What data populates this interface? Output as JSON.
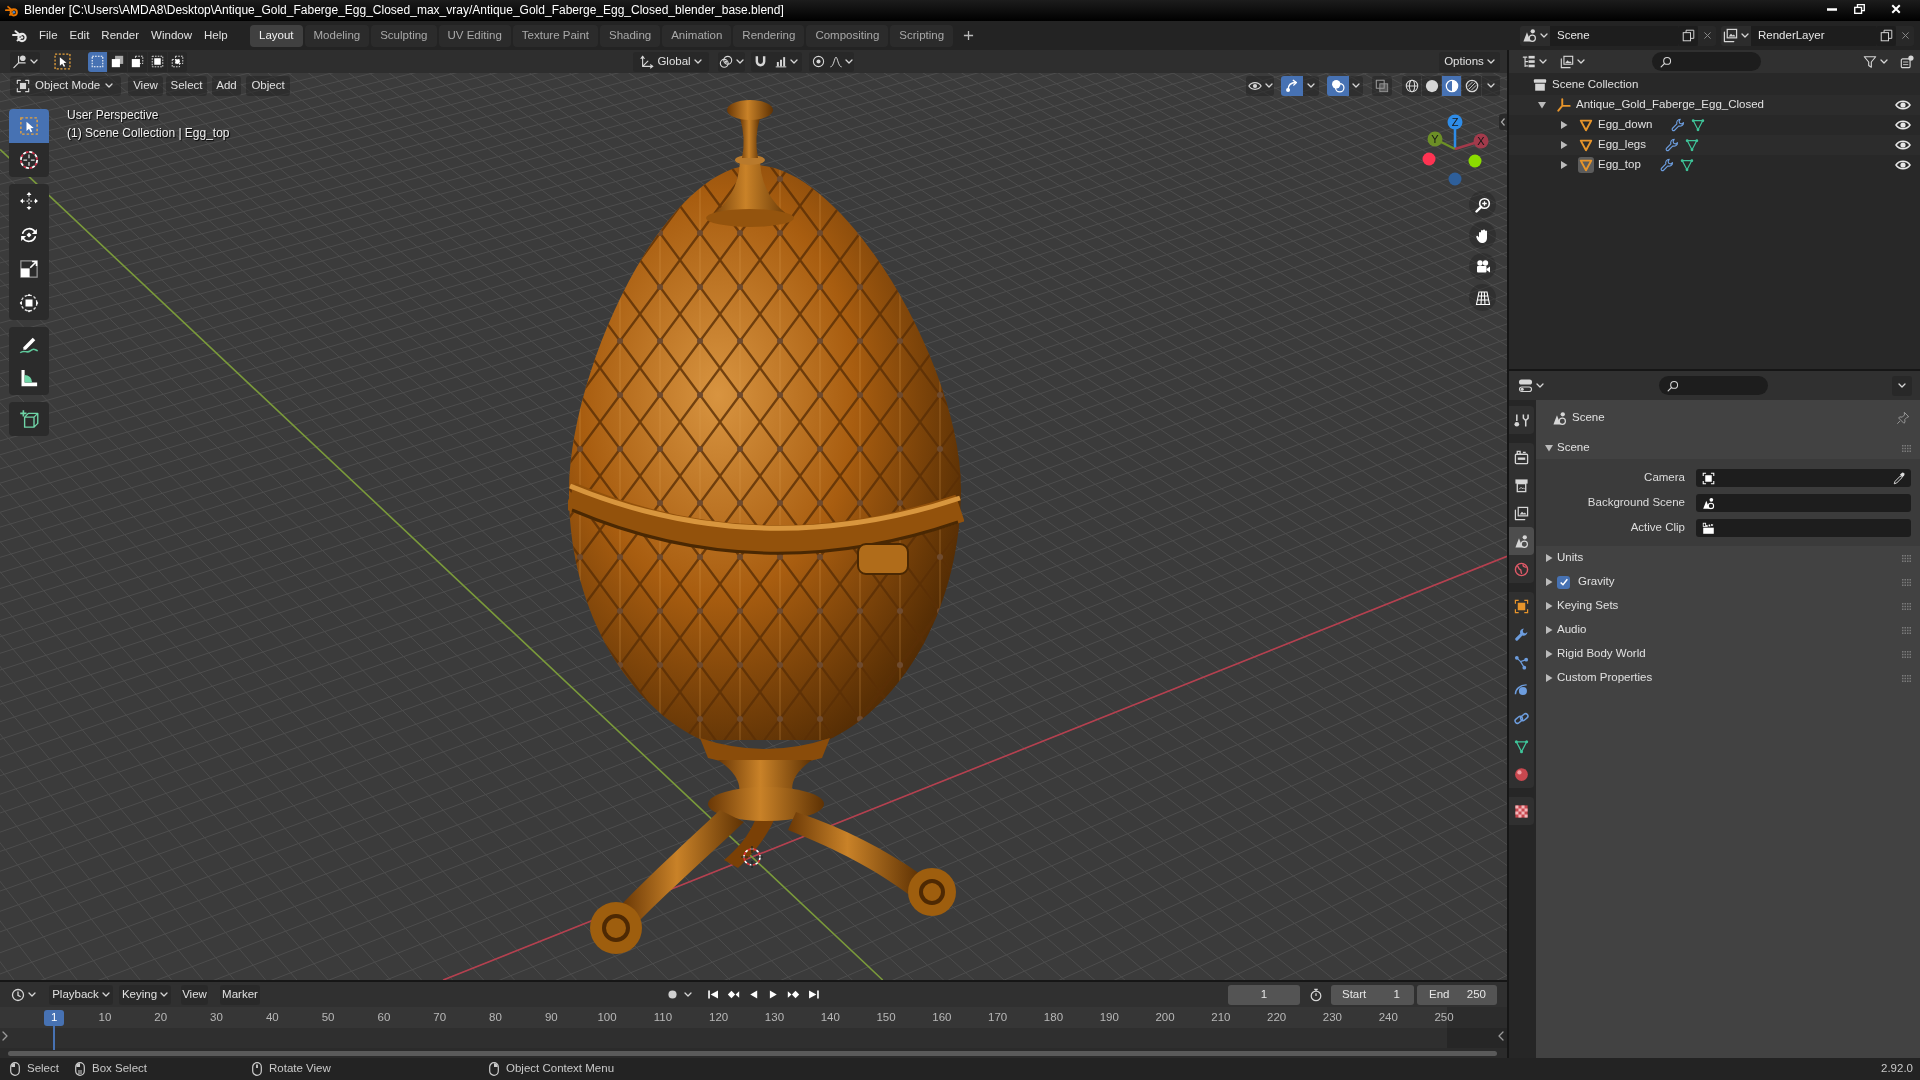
{
  "window": {
    "title": "Blender [C:\\Users\\AMDA8\\Desktop\\Antique_Gold_Faberge_Egg_Closed_max_vray/Antique_Gold_Faberge_Egg_Closed_blender_base.blend]"
  },
  "menu": [
    "File",
    "Edit",
    "Render",
    "Window",
    "Help"
  ],
  "workspaces": [
    {
      "label": "Layout",
      "selected": true
    },
    {
      "label": "Modeling",
      "selected": false
    },
    {
      "label": "Sculpting",
      "selected": false
    },
    {
      "label": "UV Editing",
      "selected": false
    },
    {
      "label": "Texture Paint",
      "selected": false
    },
    {
      "label": "Shading",
      "selected": false
    },
    {
      "label": "Animation",
      "selected": false
    },
    {
      "label": "Rendering",
      "selected": false
    },
    {
      "label": "Compositing",
      "selected": false
    },
    {
      "label": "Scripting",
      "selected": false
    }
  ],
  "scene": {
    "value": "Scene"
  },
  "view_layer": {
    "value": "RenderLayer"
  },
  "viewport": {
    "select_modes": [
      {
        "kind": "set",
        "selected": true
      },
      {
        "kind": "extend",
        "selected": false
      },
      {
        "kind": "subtract",
        "selected": false
      },
      {
        "kind": "invert",
        "selected": false
      },
      {
        "kind": "intersect",
        "selected": false
      }
    ],
    "orientation": "Global",
    "snapping": [
      {
        "kind": "snap",
        "on": false
      },
      {
        "kind": "proportional",
        "on": false
      }
    ],
    "options": "Options",
    "mode": "Object Mode",
    "menus": [
      "View",
      "Select",
      "Add",
      "Object"
    ],
    "toggles": [
      {
        "kind": "gizmo",
        "on": true
      },
      {
        "kind": "overlay",
        "on": true
      },
      {
        "kind": "xray",
        "on": false
      }
    ],
    "shading": [
      {
        "kind": "wireframe",
        "selected": false
      },
      {
        "kind": "solid",
        "selected": false
      },
      {
        "kind": "material",
        "selected": true
      },
      {
        "kind": "rendered",
        "selected": false
      }
    ],
    "toolbar": [
      [
        {
          "kind": "select_box",
          "selected": true
        },
        {
          "kind": "cursor",
          "selected": false
        }
      ],
      [
        {
          "kind": "move",
          "selected": false
        },
        {
          "kind": "rotate",
          "selected": false
        },
        {
          "kind": "scale",
          "selected": false
        },
        {
          "kind": "transform",
          "selected": false
        }
      ],
      [
        {
          "kind": "annotate",
          "selected": false
        },
        {
          "kind": "measure",
          "selected": false
        }
      ],
      [
        {
          "kind": "add_cube",
          "selected": false
        }
      ]
    ],
    "info": [
      "User Perspective",
      "(1) Scene Collection | Egg_top"
    ],
    "axes": [
      {
        "label": "Z",
        "color": "#2e8ce8"
      },
      {
        "label": "Y",
        "color": "#6c8f26"
      },
      {
        "label": "X",
        "color": "#a23a4b"
      }
    ],
    "negative_axes": [
      {
        "color": "#ff3352"
      },
      {
        "color": "#8bdc00"
      },
      {
        "color": "#2e5f9a"
      }
    ]
  },
  "outliner": {
    "root": "Scene Collection",
    "items": [
      {
        "kind": "empty",
        "label": "Antique_Gold_Faberge_Egg_Closed",
        "expanded": true,
        "visible": true,
        "children": [
          {
            "kind": "mesh",
            "label": "Egg_down",
            "expanded": false,
            "active": false,
            "visible": true
          },
          {
            "kind": "mesh",
            "label": "Egg_legs",
            "expanded": false,
            "active": false,
            "visible": true
          },
          {
            "kind": "mesh",
            "label": "Egg_top",
            "expanded": false,
            "active": true,
            "visible": true
          }
        ]
      }
    ]
  },
  "properties": {
    "tabs": [
      [
        {
          "kind": "tool",
          "selected": false
        }
      ],
      [
        {
          "kind": "render",
          "selected": false
        },
        {
          "kind": "output",
          "selected": false
        },
        {
          "kind": "view_layer",
          "selected": false
        },
        {
          "kind": "scene",
          "selected": true
        },
        {
          "kind": "world",
          "selected": false
        }
      ],
      [
        {
          "kind": "object",
          "selected": false
        },
        {
          "kind": "modifiers",
          "selected": false
        },
        {
          "kind": "particles",
          "selected": false
        },
        {
          "kind": "physics",
          "selected": false
        },
        {
          "kind": "constraints",
          "selected": false
        },
        {
          "kind": "data",
          "selected": false
        },
        {
          "kind": "material",
          "selected": false
        }
      ],
      [
        {
          "kind": "texture",
          "selected": false
        }
      ]
    ],
    "context": "Scene",
    "panels": [
      {
        "label": "Scene",
        "expanded": true,
        "fields": [
          {
            "label": "Camera",
            "kind": "object"
          },
          {
            "label": "Background Scene",
            "kind": "scene"
          },
          {
            "label": "Active Clip",
            "kind": "clip"
          }
        ]
      },
      {
        "label": "Units",
        "expanded": false
      },
      {
        "label": "Gravity",
        "expanded": false,
        "checked": true
      },
      {
        "label": "Keying Sets",
        "expanded": false
      },
      {
        "label": "Audio",
        "expanded": false
      },
      {
        "label": "Rigid Body World",
        "expanded": false
      },
      {
        "label": "Custom Properties",
        "expanded": false
      }
    ]
  },
  "timeline": {
    "menus": [
      {
        "label": "Playback",
        "kind": "dropdown"
      },
      {
        "label": "Keying",
        "kind": "dropdown"
      },
      {
        "label": "View",
        "kind": "menu"
      },
      {
        "label": "Marker",
        "kind": "menu"
      }
    ],
    "auto_keying": {
      "on": false
    },
    "current_frame": "1",
    "start": {
      "label": "Start",
      "value": "1"
    },
    "end": {
      "label": "End",
      "value": "250"
    },
    "ruler": [
      "10",
      "20",
      "30",
      "40",
      "50",
      "60",
      "70",
      "80",
      "90",
      "100",
      "110",
      "120",
      "130",
      "140",
      "150",
      "160",
      "170",
      "180",
      "190",
      "200",
      "210",
      "220",
      "230",
      "240",
      "250"
    ],
    "playhead": {
      "label": "1",
      "level": 0.036
    }
  },
  "status_bar": {
    "hints": [
      {
        "kind": "left",
        "label": "Select"
      },
      {
        "kind": "drag",
        "label": "Box Select"
      },
      {
        "kind": "middle",
        "label": "Rotate View"
      },
      {
        "kind": "right",
        "label": "Object Context Menu"
      }
    ],
    "version": "2.92.0"
  }
}
